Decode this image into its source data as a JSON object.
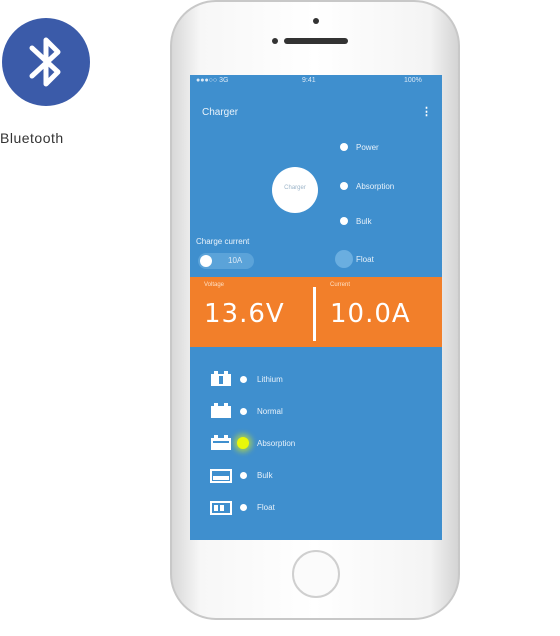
{
  "bluetooth": {
    "label": "Bluetooth",
    "icon": "bluetooth-icon",
    "color": "#3b5ba9"
  },
  "app": {
    "title": "Charger",
    "menu_icon": "more-icon",
    "status_left": "●●●○○ 3G",
    "status_center": "9:41",
    "status_right": "100%"
  },
  "charger": {
    "center_label": "Charger"
  },
  "legend": [
    {
      "label": "Power"
    },
    {
      "label": "Absorption"
    },
    {
      "label": "Bulk"
    },
    {
      "label": "Float"
    }
  ],
  "charge_current": {
    "label": "Charge current",
    "value": "10A"
  },
  "metrics": {
    "voltage": {
      "label": "Voltage",
      "value": "13.6V"
    },
    "current": {
      "label": "Current",
      "value": "10.0A"
    }
  },
  "battery_modes": [
    {
      "label": "Lithium",
      "active": false
    },
    {
      "label": "Normal",
      "active": false
    },
    {
      "label": "Absorption",
      "active": true
    },
    {
      "label": "Bulk",
      "active": false
    },
    {
      "label": "Float",
      "active": false
    }
  ],
  "colors": {
    "screen_bg": "#3f8fce",
    "metrics_bg": "#f27f2a",
    "active_led": "#e9f70a",
    "bluetooth": "#3b5ba9"
  }
}
